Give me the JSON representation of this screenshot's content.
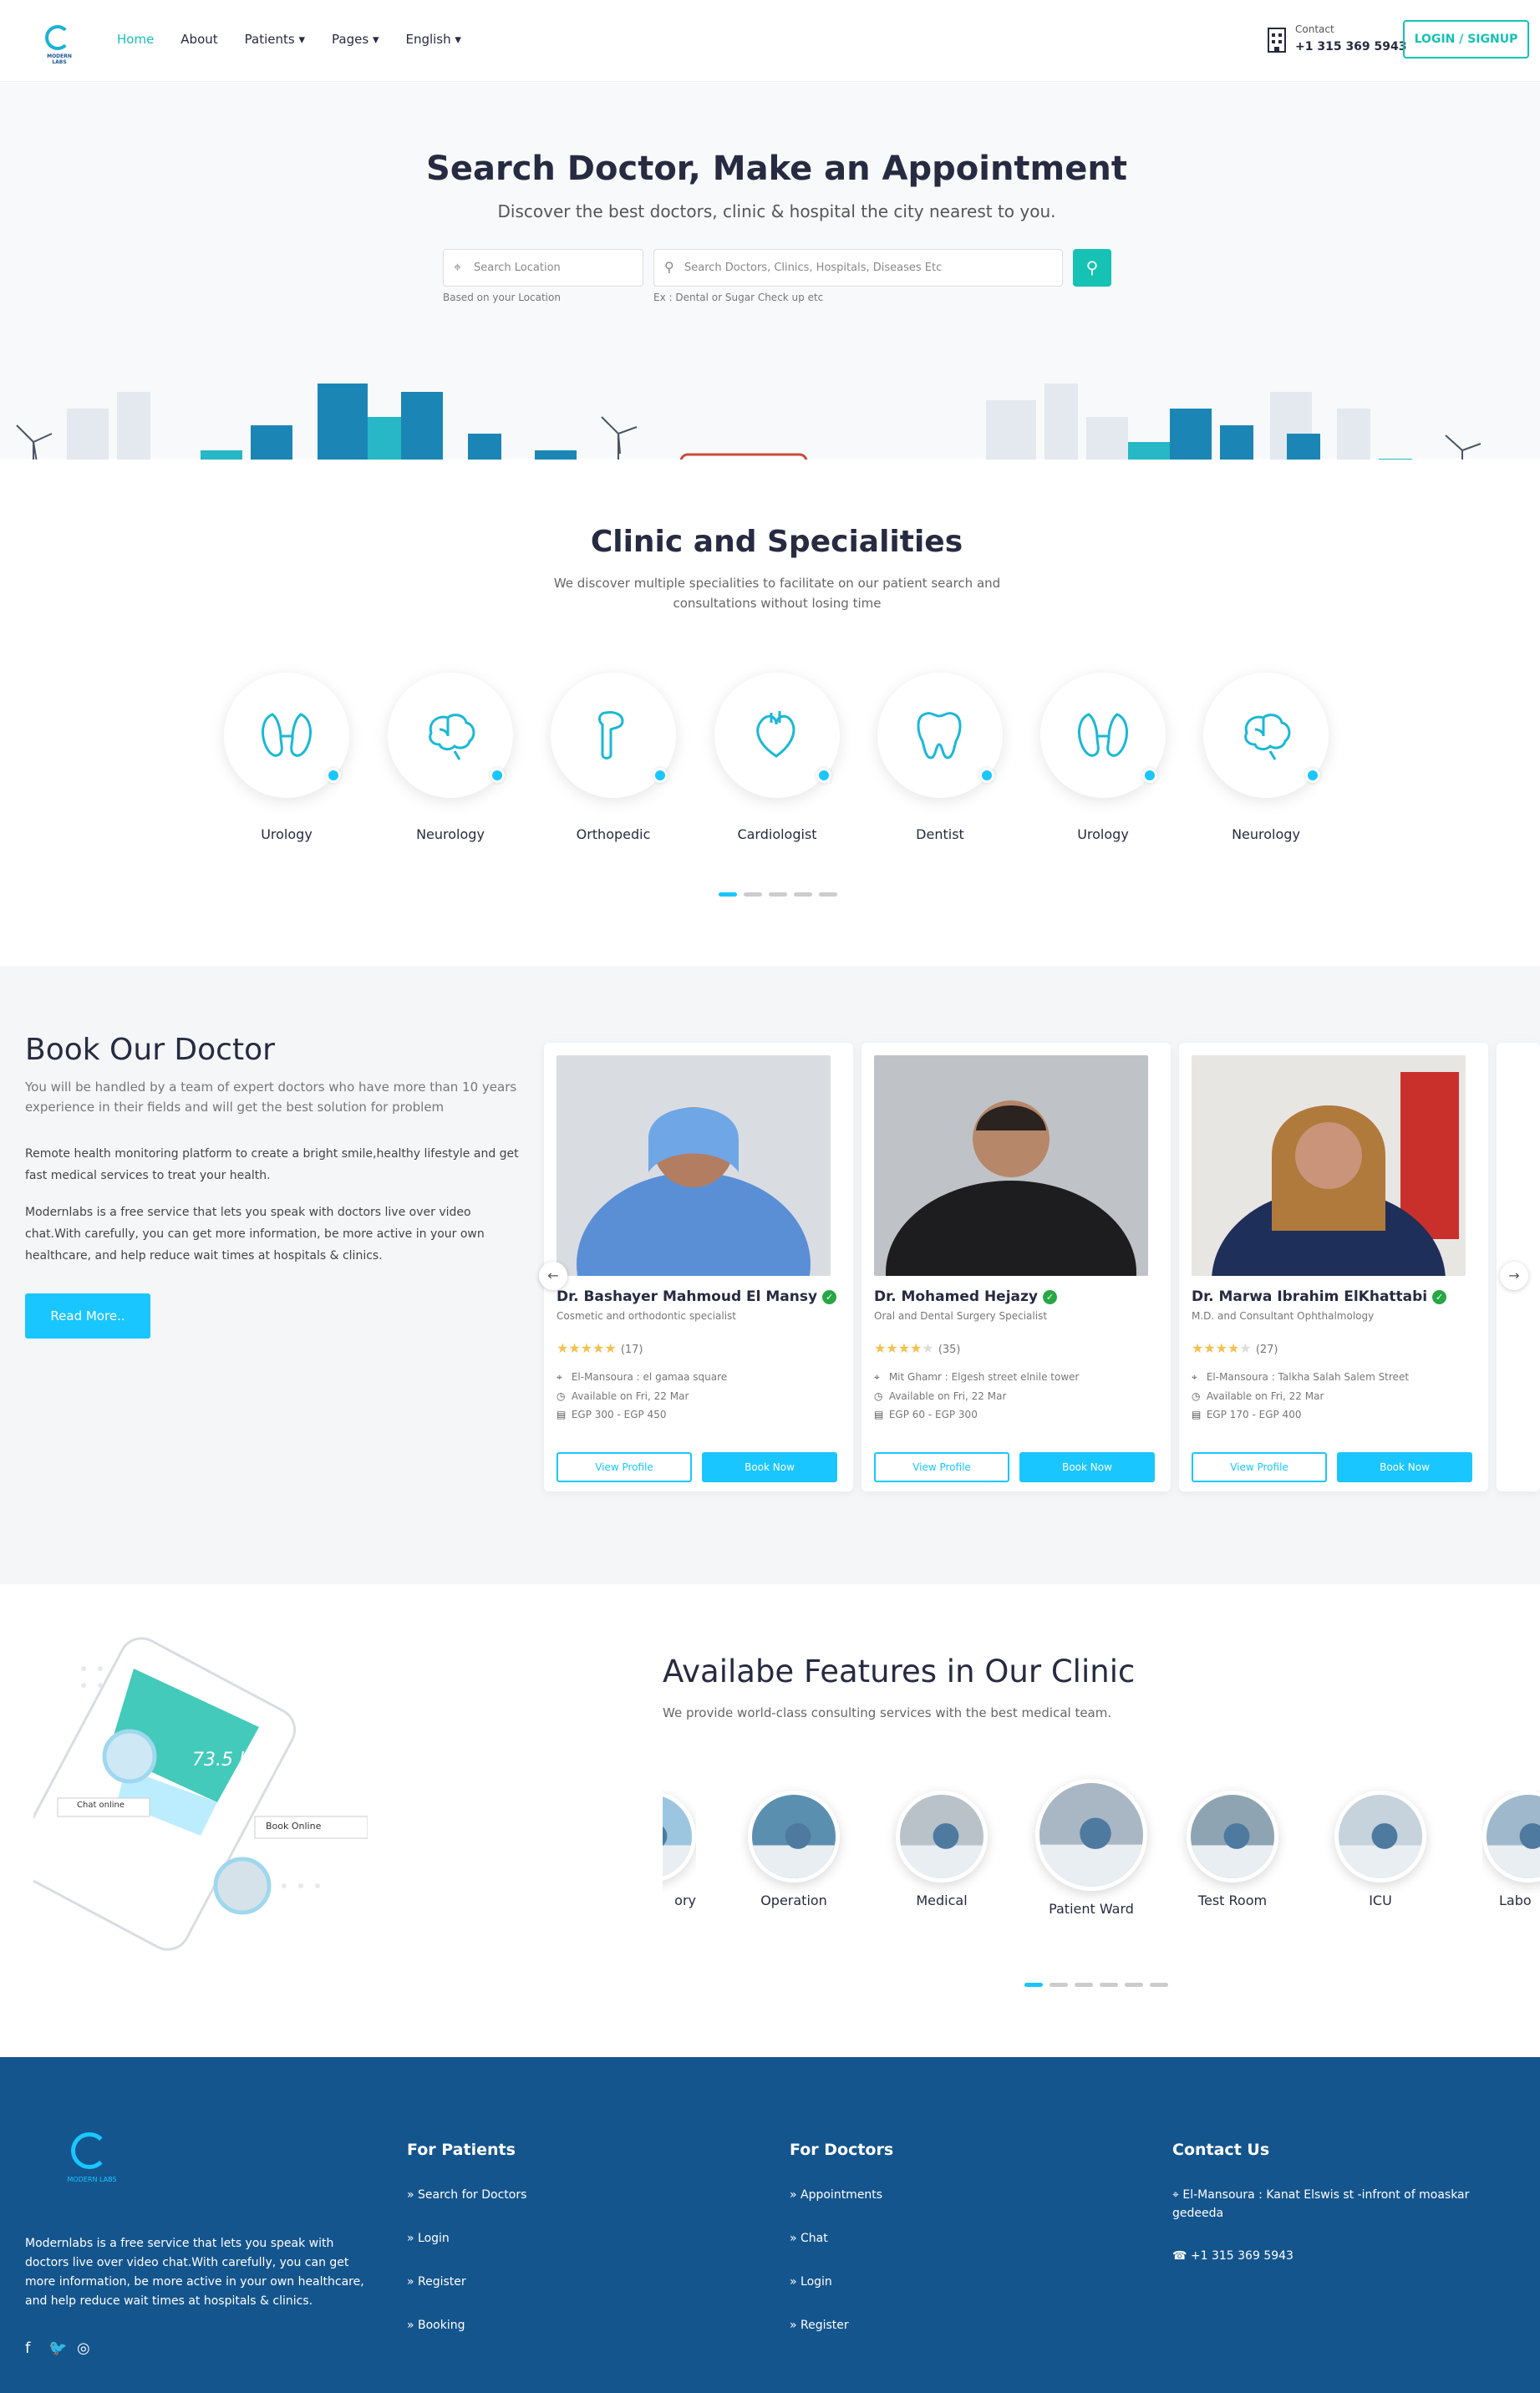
{
  "header": {
    "logo_text": "MODERN LABS",
    "nav": [
      "Home",
      "About",
      "Patients",
      "Pages",
      "English"
    ],
    "nav_caret": "▾",
    "contact_label": "Contact",
    "contact_phone": "+1 315 369 5943",
    "login": "LOGIN / SIGNUP"
  },
  "hero": {
    "title": "Search Doctor, Make an Appointment",
    "subtitle": "Discover the best doctors, clinic & hospital the city nearest to you.",
    "location_placeholder": "Search Location",
    "location_hint": "Based on your Location",
    "search_placeholder": "Search Doctors, Clinics, Hospitals, Diseases Etc",
    "search_hint": "Ex : Dental or Sugar Check up etc"
  },
  "specialities": {
    "title": "Clinic and Specialities",
    "subtitle": "We discover multiple specialities to facilitate on our patient search and consultations without losing time",
    "items": [
      {
        "label": "Urology",
        "icon": "kidney-icon"
      },
      {
        "label": "Neurology",
        "icon": "brain-icon"
      },
      {
        "label": "Orthopedic",
        "icon": "bone-icon"
      },
      {
        "label": "Cardiologist",
        "icon": "heart-icon"
      },
      {
        "label": "Dentist",
        "icon": "tooth-icon"
      },
      {
        "label": "Urology",
        "icon": "kidney-icon"
      },
      {
        "label": "Neurology",
        "icon": "brain-icon"
      }
    ]
  },
  "book": {
    "title": "Book Our Doctor",
    "subtitle": "You will be handled by a team of expert doctors who have more than 10 years experience in their fields and will get the best solution for problem",
    "para1": "Remote health monitoring platform to create a bright smile,healthy lifestyle and get fast medical services to treat your health.",
    "para2": "Modernlabs is a free service that lets you speak with doctors live over video chat.With carefully, you can get more information, be more active in your own healthcare, and help reduce wait times at hospitals & clinics.",
    "read_more": "Read More..",
    "doctors": [
      {
        "name": "Dr. Bashayer Mahmoud El Mansy",
        "spec": "Cosmetic and orthodontic specialist",
        "rating": 5,
        "stars": "★★★★★",
        "reviews": "(17)",
        "location": "El-Mansoura : el gamaa square",
        "available": "Available on Fri, 22 Mar",
        "fee": "EGP 300 - EGP 450",
        "view": "View Profile",
        "book": "Book Now"
      },
      {
        "name": "Dr. Mohamed Hejazy",
        "spec": "Oral and Dental Surgery Specialist",
        "rating": 4,
        "stars": "★★★★★",
        "reviews": "(35)",
        "location": "Mit Ghamr : Elgesh street elnile tower",
        "available": "Available on Fri, 22 Mar",
        "fee": "EGP 60 - EGP 300",
        "view": "View Profile",
        "book": "Book Now"
      },
      {
        "name": "Dr. Marwa Ibrahim ElKhattabi",
        "spec": "M.D. and Consultant Ophthalmology",
        "rating": 4,
        "stars": "★★★★★",
        "reviews": "(27)",
        "location": "El-Mansoura : Talkha Salah Salem Street",
        "available": "Available on Fri, 22 Mar",
        "fee": "EGP 170 - EGP 400",
        "view": "View Profile",
        "book": "Book Now"
      }
    ]
  },
  "features": {
    "title": "Availabe Features in Our Clinic",
    "subtitle": "We provide world-class consulting services with the best medical team.",
    "items": [
      "ory",
      "Operation",
      "Medical",
      "Patient Ward",
      "Test Room",
      "ICU",
      "Labo"
    ],
    "phone": {
      "weight": "73.5 kg",
      "chat": "Chat online",
      "book": "Book Online"
    }
  },
  "footer": {
    "desc": "Modernlabs is a free service that lets you speak with doctors live over video chat.With carefully, you can get more information, be more active in your own healthcare, and help reduce wait times at hospitals & clinics.",
    "patients_title": "For Patients",
    "patients": [
      "Search for Doctors",
      "Login",
      "Register",
      "Booking"
    ],
    "doctors_title": "For Doctors",
    "doctors": [
      "Appointments",
      "Chat",
      "Login",
      "Register"
    ],
    "contact_title": "Contact Us",
    "address": "El-Mansoura : Kanat Elswis st -infront of moaskar gedeeda",
    "phone": "+1 315 369 5943"
  },
  "colors": {
    "accent": "#15c2b3",
    "blue": "#1ac6ff",
    "footer": "#15558d"
  }
}
